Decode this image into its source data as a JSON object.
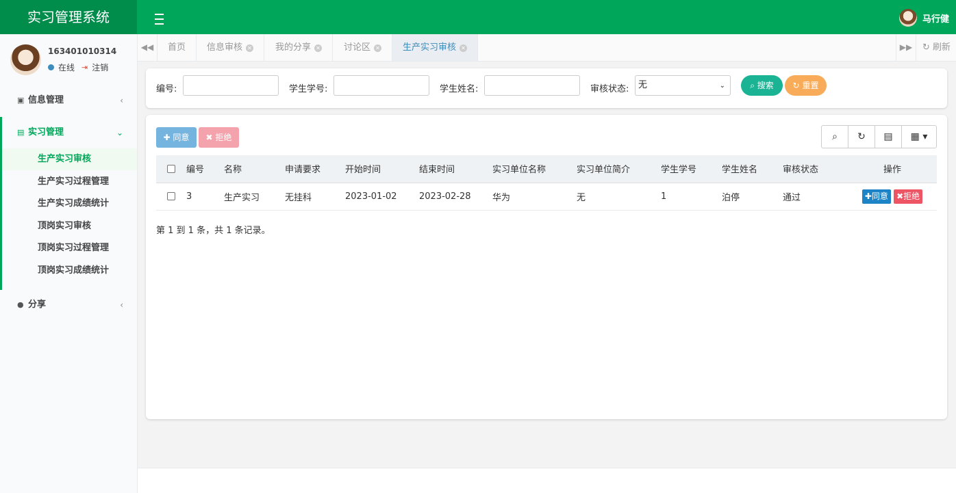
{
  "app": {
    "title": "实习管理系统"
  },
  "header": {
    "user_name": "马行健"
  },
  "sidebar": {
    "user": {
      "id": "163401010314",
      "status": "在线",
      "logout": "注销"
    },
    "menu": [
      {
        "label": "信息管理",
        "icon": "id-card-icon"
      },
      {
        "label": "实习管理",
        "icon": "address-card-icon",
        "children": [
          "生产实习审核",
          "生产实习过程管理",
          "生产实习成绩统计",
          "顶岗实习审核",
          "顶岗实习过程管理",
          "顶岗实习成绩统计"
        ]
      },
      {
        "label": "分享",
        "icon": "comment-icon"
      }
    ]
  },
  "tabs": {
    "items": [
      "首页",
      "信息审核",
      "我的分享",
      "讨论区",
      "生产实习审核"
    ],
    "active": "生产实习审核",
    "refresh": "刷新"
  },
  "search": {
    "labels": [
      "编号:",
      "学生学号:",
      "学生姓名:",
      "审核状态:"
    ],
    "status_value": "无",
    "search_btn": "搜索",
    "reset_btn": "重置"
  },
  "toolbar": {
    "approve": "同意",
    "reject": "拒绝"
  },
  "table": {
    "headers": [
      "编号",
      "名称",
      "申请要求",
      "开始时间",
      "结束时间",
      "实习单位名称",
      "实习单位简介",
      "学生学号",
      "学生姓名",
      "审核状态",
      "操作"
    ],
    "rows": [
      [
        "3",
        "生产实习",
        "无挂科",
        "2023-01-02",
        "2023-02-28",
        "华为",
        "无",
        "1",
        "泊停",
        "通过"
      ]
    ],
    "row_actions": {
      "approve": "同意",
      "reject": "拒绝"
    },
    "summary": "第 1 到 1 条，共 1 条记录。"
  },
  "colors": {
    "primary": "#00a65a",
    "primary_dark": "#008d4c",
    "blue": "#3c8dbc",
    "teal": "#1ab394",
    "orange": "#f8ac59",
    "red": "#ed5565",
    "btn_blue": "#1c84c6"
  }
}
